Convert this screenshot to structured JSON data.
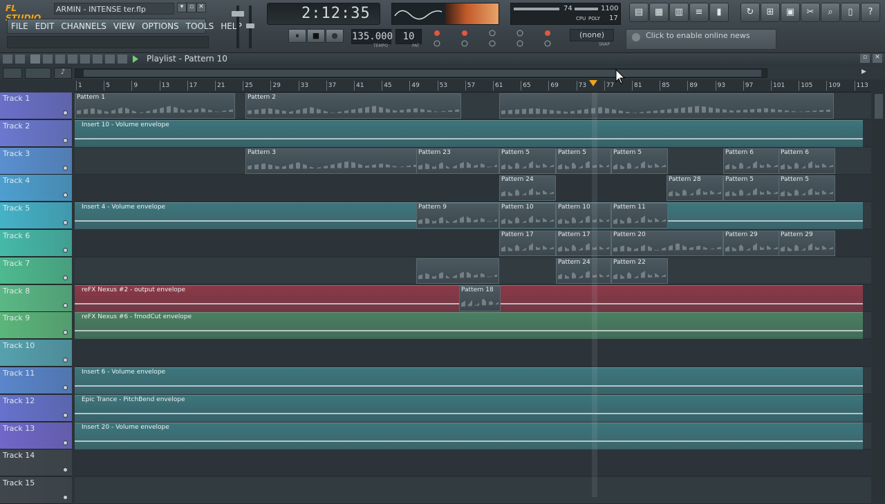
{
  "app": {
    "logo": "FL STUDIO",
    "window_title": "ARMIN - INTENSE ter.flp",
    "window_buttons": [
      "▾",
      "▫",
      "✕"
    ]
  },
  "menu": [
    "FILE",
    "EDIT",
    "CHANNELS",
    "VIEW",
    "OPTIONS",
    "TOOLS",
    "HELP"
  ],
  "transport": {
    "time": "2:12:35",
    "tempo": "135.000",
    "tempo_label": "TEMPO",
    "pattern": "10",
    "pattern_label": "PAT",
    "snap_value": "(none)",
    "snap_label": "SNAP",
    "pause_icon": "⏸",
    "stop_icon": "■",
    "record_icon": "●"
  },
  "cpu": {
    "cpu_value": "74",
    "mem_value": "1100",
    "poly_value": "17",
    "cpu_label": "CPU",
    "poly_label": "POLY"
  },
  "news": {
    "text": "Click to enable online news"
  },
  "toolbar_icons": [
    "playlist-icon",
    "piano-roll-icon",
    "step-seq-icon",
    "mixer-icon",
    "browser-icon",
    "undo-icon",
    "save-icon",
    "plugin-icon",
    "tools-icon",
    "search-icon",
    "help-icon"
  ],
  "playlist": {
    "title": "Playlist - Pattern 10",
    "ruler": [
      "1",
      "5",
      "9",
      "13",
      "17",
      "21",
      "25",
      "29",
      "33",
      "37",
      "41",
      "45",
      "49",
      "53",
      "57",
      "61",
      "65",
      "69",
      "73",
      "77",
      "81",
      "85",
      "89",
      "93",
      "97",
      "101",
      "105",
      "109",
      "113"
    ],
    "tracks": [
      {
        "name": "Track 1",
        "color": "#6b6fc8"
      },
      {
        "name": "Track 2",
        "color": "#6b78cf"
      },
      {
        "name": "Track 3",
        "color": "#5a8fd0"
      },
      {
        "name": "Track 4",
        "color": "#4d9fcf"
      },
      {
        "name": "Track 5",
        "color": "#45b2c8"
      },
      {
        "name": "Track 6",
        "color": "#46b9a8"
      },
      {
        "name": "Track 7",
        "color": "#4eb98e"
      },
      {
        "name": "Track 8",
        "color": "#5bb884"
      },
      {
        "name": "Track 9",
        "color": "#5cb67a"
      },
      {
        "name": "Track 10",
        "color": "#56a1ae"
      },
      {
        "name": "Track 11",
        "color": "#5a86cc"
      },
      {
        "name": "Track 12",
        "color": "#6672cc"
      },
      {
        "name": "Track 13",
        "color": "#7067c8"
      },
      {
        "name": "Track 14",
        "color": "#3f474c"
      },
      {
        "name": "Track 15",
        "color": "#3f474c"
      }
    ],
    "clips": {
      "t1": [
        "Pattern 1",
        "Pattern 2"
      ],
      "t2_env": "Insert 10 - Volume envelope",
      "t3": [
        "Pattern 3",
        "Pattern 23",
        "Pattern 5",
        "Pattern 5",
        "Pattern 5",
        "Pattern 6",
        "Pattern 6"
      ],
      "t4": [
        "Pattern 24",
        "Pattern 28",
        "Pattern 5",
        "Pattern 5"
      ],
      "t5_env": "Insert 4 - Volume envelope",
      "t5": [
        "Pattern 9",
        "Pattern 10",
        "Pattern 10",
        "Pattern 11"
      ],
      "t6": [
        "Pattern 17",
        "Pattern 17",
        "Pattern 20",
        "Pattern 29",
        "Pattern 29"
      ],
      "t7": [
        "Pattern 24",
        "Pattern 22"
      ],
      "t8_env": "reFX Nexus #2 - output envelope",
      "t8": [
        "Pattern 18"
      ],
      "t9_env": "reFX Nexus #6 - fmodCut envelope",
      "t11_env": "Insert 6 - Volume envelope",
      "t12_env": "Epic Trance - PitchBend envelope",
      "t13_env": "Insert 20 - Volume envelope"
    }
  },
  "colors": {
    "accent": "#f2a51a",
    "env_teal": "#3f7f86",
    "env_red": "#9b3a4a",
    "env_green": "#4d8a66"
  }
}
